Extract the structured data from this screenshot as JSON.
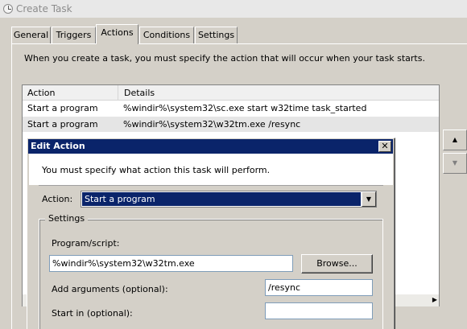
{
  "window": {
    "title": "Create Task"
  },
  "tabs": [
    {
      "label": "General"
    },
    {
      "label": "Triggers"
    },
    {
      "label": "Actions"
    },
    {
      "label": "Conditions"
    },
    {
      "label": "Settings"
    }
  ],
  "actions_tab": {
    "intro": "When you create a task, you must specify the action that will occur when your task starts.",
    "columns": [
      "Action",
      "Details"
    ],
    "rows": [
      {
        "action": "Start a program",
        "details": "%windir%\\system32\\sc.exe start w32time task_started"
      },
      {
        "action": "Start a program",
        "details": "%windir%\\system32\\w32tm.exe /resync"
      }
    ]
  },
  "edit_action": {
    "title": "Edit Action",
    "close_label": "✕",
    "instruction": "You must specify what action this task will perform.",
    "action_label": "Action:",
    "action_value": "Start a program",
    "settings_label": "Settings",
    "program_label": "Program/script:",
    "program_value": "%windir%\\system32\\w32tm.exe",
    "browse_label": "Browse...",
    "args_label": "Add arguments (optional):",
    "args_value": "/resync",
    "startin_label": "Start in (optional):",
    "startin_value": ""
  },
  "icons": {
    "title": "clock-icon",
    "up": "arrow-up-icon",
    "down": "arrow-down-icon",
    "dropdown": "chevron-down-icon"
  },
  "colors": {
    "selection": "#0a246a",
    "dialog_face": "#d4d0c8"
  }
}
